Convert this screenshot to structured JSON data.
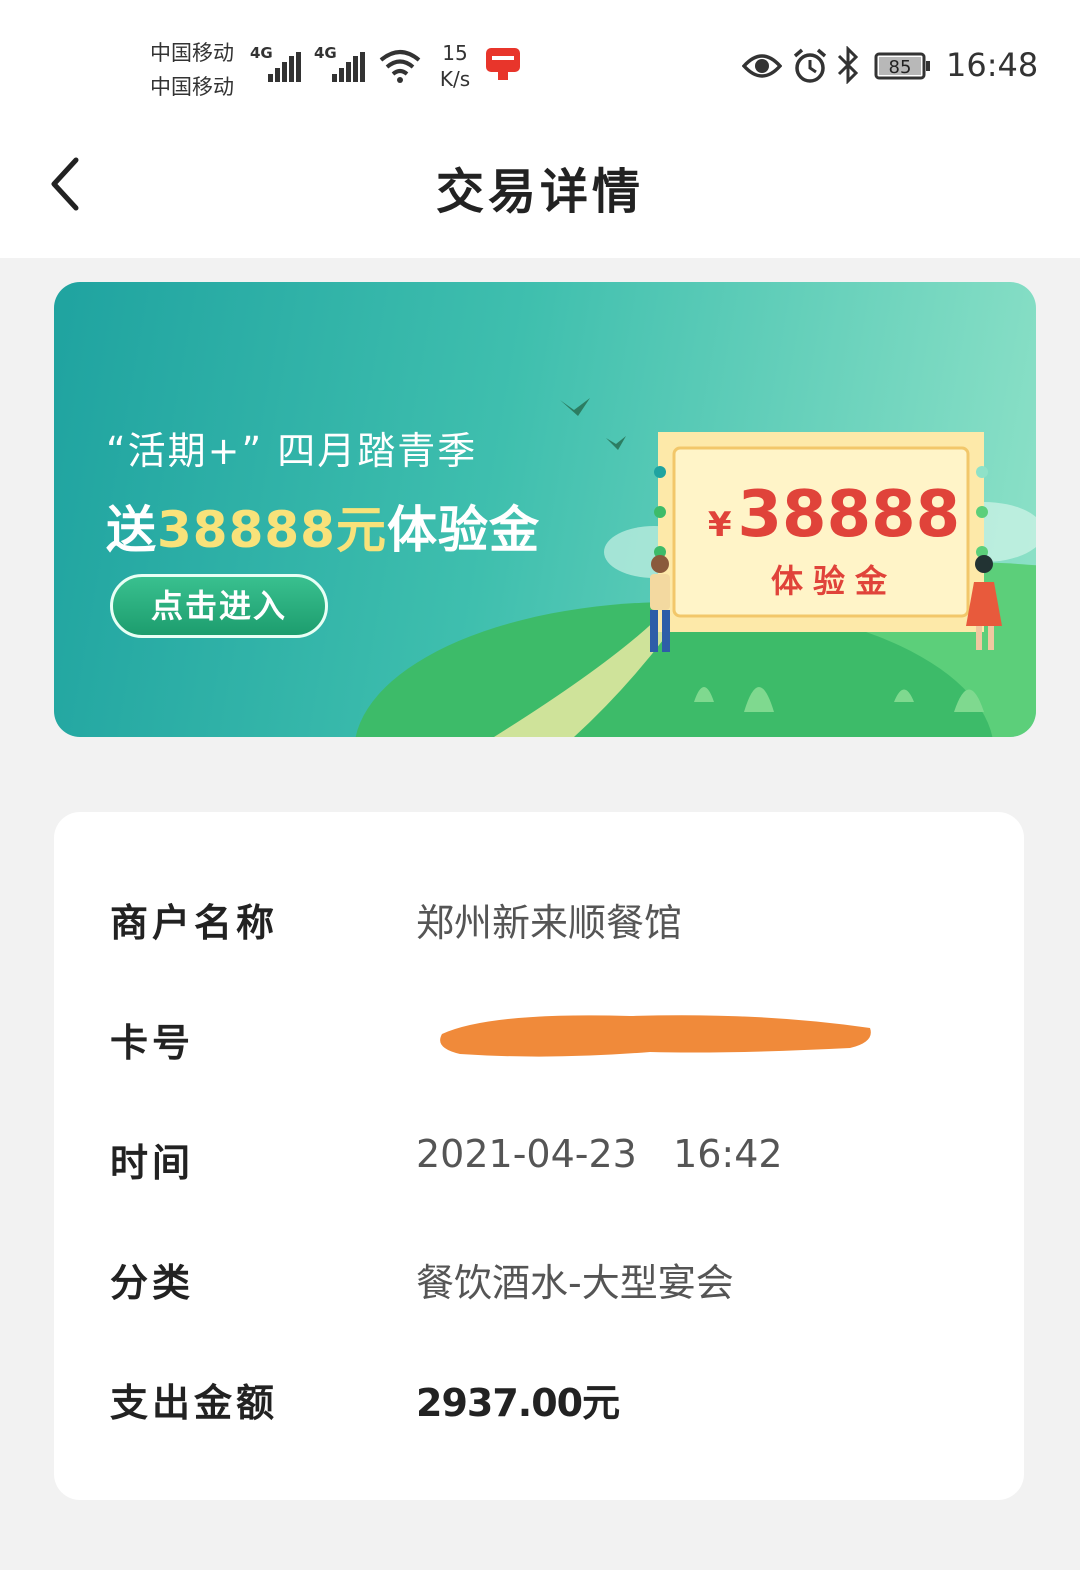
{
  "status_bar": {
    "carrier_1": "中国移动",
    "carrier_2": "中国移动",
    "network_1": "4G",
    "network_2": "4G",
    "speed_value": "15",
    "speed_unit": "K/s",
    "battery": "85",
    "time": "16:48"
  },
  "nav": {
    "title": "交易详情"
  },
  "banner": {
    "subtitle": "“活期+” 四月踏青季",
    "main_prefix": "送",
    "main_highlight": "38888元",
    "main_suffix": "体验金",
    "button_label": "点击进入",
    "ticket_currency": "¥",
    "ticket_amount": "38888",
    "ticket_label": "体验金"
  },
  "details": {
    "merchant_label": "商户名称",
    "merchant_value": "郑州新来顺餐馆",
    "card_label": "卡号",
    "time_label": "时间",
    "time_value": "2021-04-23   16:42",
    "category_label": "分类",
    "category_value": "餐饮酒水-大型宴会",
    "amount_label": "支出金额",
    "amount_value": "2937.00元"
  },
  "colors": {
    "accent_amount": "#e0433a",
    "highlight": "#f8e27a",
    "redaction": "#f08a3a"
  }
}
